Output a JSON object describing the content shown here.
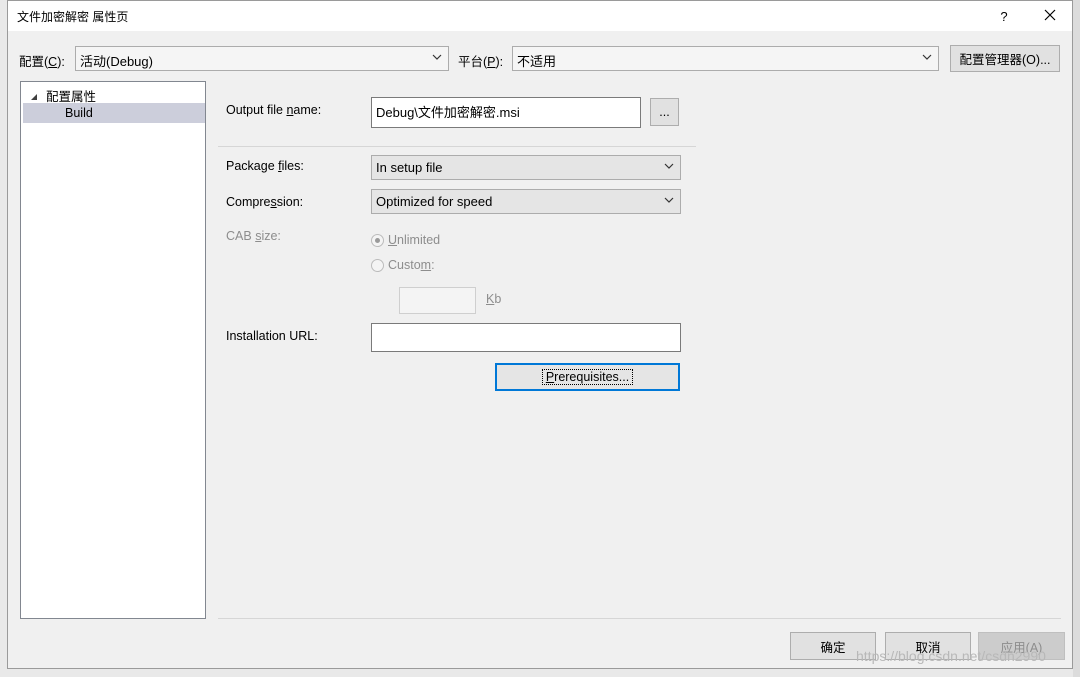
{
  "window": {
    "title": "文件加密解密 属性页",
    "help_label": "?",
    "close_label": "✕"
  },
  "top": {
    "config_label_pre": "配置(",
    "config_label_key": "C",
    "config_label_post": "):",
    "config_value": "活动(Debug)",
    "platform_label_pre": "平台(",
    "platform_label_key": "P",
    "platform_label_post": "):",
    "platform_value": "不适用",
    "config_manager_label": "配置管理器(O)..."
  },
  "tree": {
    "root_label": "配置属性",
    "child_label": "Build"
  },
  "form": {
    "output_label_pre": "Output file ",
    "output_label_key": "n",
    "output_label_post": "ame:",
    "output_value": "Debug\\文件加密解密.msi",
    "browse_label": "...",
    "package_label_pre": "Package ",
    "package_label_key": "f",
    "package_label_post": "iles:",
    "package_value": "In setup file",
    "compression_label_pre": "Compre",
    "compression_label_key": "s",
    "compression_label_post": "sion:",
    "compression_value": "Optimized for speed",
    "cab_label_pre": "CAB ",
    "cab_label_key": "s",
    "cab_label_post": "ize:",
    "unlimited_key": "U",
    "unlimited_rest": "nlimited",
    "custom_pre": "Custo",
    "custom_key": "m",
    "custom_post": ":",
    "custom_value": "",
    "kb_key": "K",
    "kb_rest": "b",
    "installation_label": "Installation URL:",
    "installation_value": "",
    "prereq_key": "P",
    "prereq_rest": "rerequisites..."
  },
  "footer": {
    "ok_label": "确定",
    "cancel_label": "取消",
    "apply_label": "应用(A)"
  },
  "watermark": "https://blog.csdn.net/csdn2990",
  "colors": {
    "tree_selection": "#cccedb",
    "focus_border": "#0078d7",
    "disabled_text": "#8d8d8d"
  }
}
